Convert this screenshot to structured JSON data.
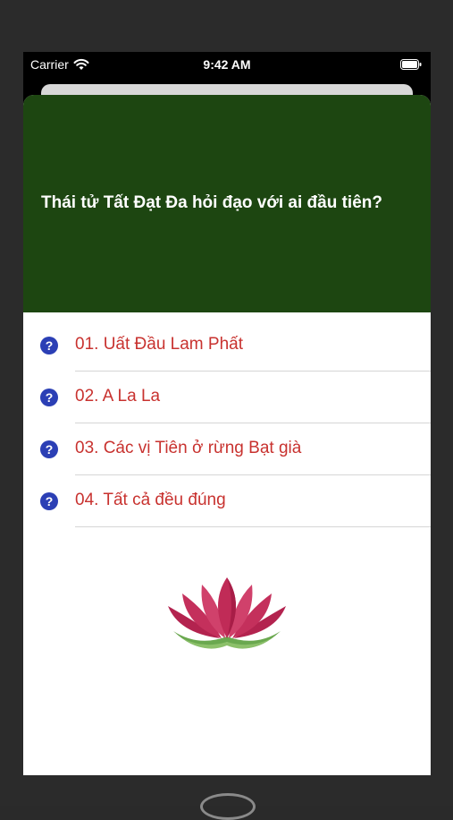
{
  "status_bar": {
    "carrier": "Carrier",
    "time": "9:42 AM"
  },
  "quiz": {
    "question": "Thái tử Tất Đạt Đa hỏi đạo với ai đầu tiên?",
    "header_color": "#1d4611",
    "answer_color": "#c8322f",
    "answers": [
      {
        "label": "01. Uất Đầu Lam Phất"
      },
      {
        "label": "02. A La La"
      },
      {
        "label": "03. Các vị Tiên ở rừng Bạt già"
      },
      {
        "label": "04. Tất cả đều đúng"
      }
    ]
  },
  "icons": {
    "answer_icon": "question-circle-icon",
    "logo": "lotus-logo-icon"
  }
}
